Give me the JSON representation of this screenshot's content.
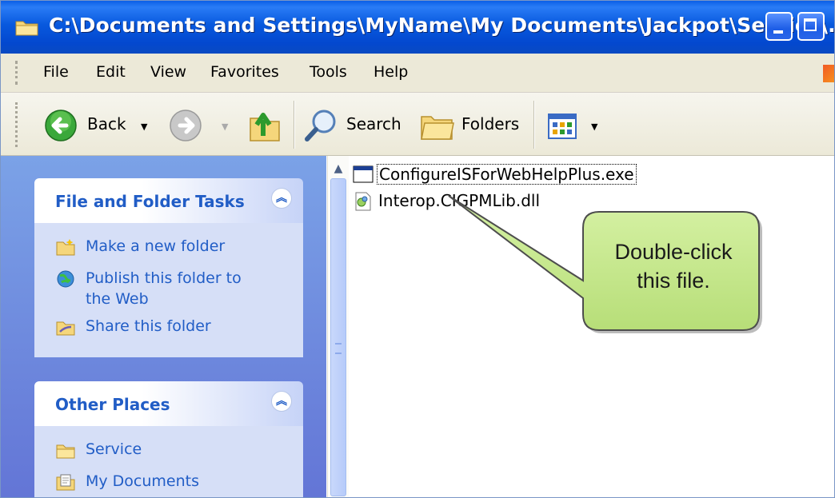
{
  "window": {
    "title": "C:\\Documents and Settings\\MyName\\My Documents\\Jackpot\\Service\\..."
  },
  "menu": [
    "File",
    "Edit",
    "View",
    "Favorites",
    "Tools",
    "Help"
  ],
  "toolbar": {
    "back_label": "Back",
    "search_label": "Search",
    "folders_label": "Folders"
  },
  "task_pane": {
    "file_folder_tasks": {
      "title": "File and Folder Tasks",
      "items": [
        "Make a new folder",
        "Publish this folder to",
        "the Web",
        "Share this folder"
      ]
    },
    "other_places": {
      "title": "Other Places",
      "items": [
        "Service",
        "My Documents"
      ]
    }
  },
  "files": [
    {
      "name": "ConfigureISForWebHelpPlus.exe",
      "icon": "exe-icon",
      "selected": true
    },
    {
      "name": "Interop.CIGPMLib.dll",
      "icon": "dll-icon",
      "selected": false
    }
  ],
  "callout": {
    "line1": "Double-click",
    "line2": "this file."
  },
  "colors": {
    "titlebar": "#0859de",
    "task_link": "#215dc6",
    "callout_fill": "#c5e88a"
  }
}
